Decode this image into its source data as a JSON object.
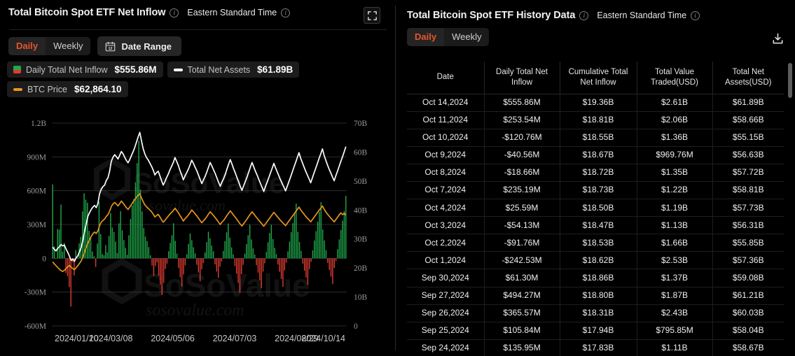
{
  "left": {
    "title": "Total Bitcoin Spot ETF Net Inflow",
    "timezone": "Eastern Standard Time",
    "info_glyph": "i",
    "fullscreen_icon": "fullscreen-icon",
    "period": {
      "daily": "Daily",
      "weekly": "Weekly",
      "active": "Daily"
    },
    "date_range_label": "Date Range",
    "calendar_icon_number": "12",
    "legend": [
      {
        "name": "Daily Total Net Inflow",
        "value": "$555.86M",
        "swatch": "split",
        "color_top": "#1faa4b",
        "color_bottom": "#e03c31"
      },
      {
        "name": "Total Net Assets",
        "value": "$61.89B",
        "swatch": "bar",
        "color": "#ffffff"
      },
      {
        "name": "BTC Price",
        "value": "$62,864.10",
        "swatch": "bar",
        "color": "#e8961e"
      }
    ],
    "watermark_main": "SoSoValue",
    "watermark_sub": "sosovalue.com"
  },
  "right": {
    "title": "Total Bitcoin Spot ETF History Data",
    "timezone": "Eastern Standard Time",
    "period": {
      "daily": "Daily",
      "weekly": "Weekly",
      "active": "Daily"
    },
    "download_icon": "download-icon",
    "columns": [
      "Date",
      "Daily Total Net Inflow",
      "Cumulative Total Net Inflow",
      "Total Value Traded(USD)",
      "Total Net Assets(USD)"
    ],
    "rows": [
      {
        "date": "Oct 14,2024",
        "daily": "$555.86M",
        "sign": "pos",
        "cum": "$19.36B",
        "traded": "$2.61B",
        "assets": "$61.89B"
      },
      {
        "date": "Oct 11,2024",
        "daily": "$253.54M",
        "sign": "pos",
        "cum": "$18.81B",
        "traded": "$2.06B",
        "assets": "$58.66B"
      },
      {
        "date": "Oct 10,2024",
        "daily": "-$120.76M",
        "sign": "neg",
        "cum": "$18.55B",
        "traded": "$1.36B",
        "assets": "$55.15B"
      },
      {
        "date": "Oct 9,2024",
        "daily": "-$40.56M",
        "sign": "neg",
        "cum": "$18.67B",
        "traded": "$969.76M",
        "assets": "$56.63B"
      },
      {
        "date": "Oct 8,2024",
        "daily": "-$18.66M",
        "sign": "neg",
        "cum": "$18.72B",
        "traded": "$1.35B",
        "assets": "$57.72B"
      },
      {
        "date": "Oct 7,2024",
        "daily": "$235.19M",
        "sign": "pos",
        "cum": "$18.73B",
        "traded": "$1.22B",
        "assets": "$58.81B"
      },
      {
        "date": "Oct 4,2024",
        "daily": "$25.59M",
        "sign": "pos",
        "cum": "$18.50B",
        "traded": "$1.19B",
        "assets": "$57.73B"
      },
      {
        "date": "Oct 3,2024",
        "daily": "-$54.13M",
        "sign": "neg",
        "cum": "$18.47B",
        "traded": "$1.13B",
        "assets": "$56.31B"
      },
      {
        "date": "Oct 2,2024",
        "daily": "-$91.76M",
        "sign": "neg",
        "cum": "$18.53B",
        "traded": "$1.66B",
        "assets": "$55.85B"
      },
      {
        "date": "Oct 1,2024",
        "daily": "-$242.53M",
        "sign": "neg",
        "cum": "$18.62B",
        "traded": "$2.53B",
        "assets": "$57.36B"
      },
      {
        "date": "Sep 30,2024",
        "daily": "$61.30M",
        "sign": "pos",
        "cum": "$18.86B",
        "traded": "$1.37B",
        "assets": "$59.08B"
      },
      {
        "date": "Sep 27,2024",
        "daily": "$494.27M",
        "sign": "pos",
        "cum": "$18.80B",
        "traded": "$1.87B",
        "assets": "$61.21B"
      },
      {
        "date": "Sep 26,2024",
        "daily": "$365.57M",
        "sign": "pos",
        "cum": "$18.31B",
        "traded": "$2.43B",
        "assets": "$60.03B"
      },
      {
        "date": "Sep 25,2024",
        "daily": "$105.84M",
        "sign": "pos",
        "cum": "$17.94B",
        "traded": "$795.85M",
        "assets": "$58.04B"
      },
      {
        "date": "Sep 24,2024",
        "daily": "$135.95M",
        "sign": "pos",
        "cum": "$17.83B",
        "traded": "$1.11B",
        "assets": "$58.67B"
      }
    ],
    "watermark_main": "SoSoValue",
    "watermark_sub": "sosovalue.com"
  },
  "chart_data": {
    "type": "bar",
    "title": "Total Bitcoin Spot ETF Net Inflow",
    "xlabel": "",
    "ylabel": "Daily Total Net Inflow",
    "y2label": "Total Net Assets / BTC Price",
    "grid": true,
    "legend_position": "top-left",
    "ylim": [
      -600000000,
      1200000000
    ],
    "y2lim": [
      0,
      70000000000
    ],
    "yticks": [
      "-600M",
      "-300M",
      "0",
      "300M",
      "600M",
      "900M",
      "1.2B"
    ],
    "y2ticks": [
      "0",
      "10B",
      "20B",
      "30B",
      "40B",
      "50B",
      "60B",
      "70B"
    ],
    "xticks": [
      "2024/01/10",
      "2024/03/08",
      "2024/05/06",
      "2024/07/03",
      "2024/08/29",
      "2024/10/14"
    ],
    "colors": {
      "positive_bar": "#1faa4b",
      "negative_bar": "#e03c31",
      "net_assets_line": "#ffffff",
      "btc_price_line": "#e8961e"
    },
    "series": [
      {
        "name": "Daily Total Net Inflow",
        "type": "bar",
        "axis": "left",
        "values": [
          655,
          106,
          -6,
          261,
          255,
          477,
          59,
          137,
          -131,
          -158,
          -255,
          -428,
          -36,
          -152,
          73,
          6,
          132,
          190,
          416,
          576,
          520,
          493,
          243,
          183,
          60,
          18,
          -76,
          131,
          505,
          215,
          38,
          27,
          117,
          53,
          198,
          402,
          273,
          233,
          148,
          47,
          310,
          418,
          248,
          162,
          93,
          32,
          205,
          349,
          468,
          527,
          676,
          845,
          1045,
          610,
          417,
          268,
          193,
          152,
          100,
          27,
          -64,
          -156,
          -68,
          -36,
          -154,
          -233,
          -326,
          -218,
          -95,
          -47,
          63,
          137,
          205,
          311,
          155,
          42,
          -87,
          -168,
          -251,
          -143,
          -62,
          35,
          128,
          220,
          161,
          98,
          44,
          -58,
          -126,
          -204,
          -98,
          -43,
          52,
          144,
          236,
          178,
          113,
          63,
          -54,
          -118,
          -173,
          -75,
          -28,
          66,
          152,
          231,
          309,
          184,
          97,
          36,
          -69,
          -137,
          -219,
          -306,
          -141,
          -58,
          41,
          126,
          206,
          298,
          167,
          88,
          33,
          -61,
          -127,
          -196,
          -265,
          -118,
          -44,
          56,
          143,
          225,
          297,
          171,
          92,
          38,
          -56,
          -119,
          -183,
          -253,
          -107,
          -39,
          61,
          148,
          232,
          312,
          404,
          486,
          235,
          145,
          66,
          -48,
          -110,
          -171,
          -236,
          -96,
          -31,
          71,
          158,
          241,
          325,
          412,
          498,
          256,
          159,
          73,
          -41,
          -103,
          -162,
          -228,
          -86,
          -25,
          81,
          168,
          251,
          335,
          421,
          555
        ],
        "unit": "millions USD"
      },
      {
        "name": "Total Net Assets",
        "type": "line",
        "axis": "right",
        "values": [
          27.2,
          26.4,
          25.9,
          26.8,
          27.3,
          28.1,
          27.6,
          27.9,
          26.5,
          25.4,
          24.1,
          22.6,
          23.1,
          22.3,
          23.5,
          24.2,
          25.6,
          27.1,
          29.4,
          32.6,
          35.2,
          37.8,
          39.1,
          40.2,
          41.0,
          41.6,
          40.8,
          42.3,
          45.6,
          47.2,
          48.1,
          48.6,
          50.2,
          51.1,
          53.4,
          56.8,
          58.2,
          59.1,
          58.4,
          57.6,
          58.9,
          60.2,
          59.4,
          58.2,
          57.1,
          56.3,
          57.4,
          58.8,
          60.1,
          61.6,
          63.4,
          65.2,
          66.8,
          63.9,
          61.2,
          59.4,
          58.1,
          57.3,
          56.2,
          55.1,
          53.8,
          52.1,
          52.9,
          53.4,
          51.8,
          50.1,
          48.6,
          49.8,
          51.2,
          52.4,
          53.9,
          55.1,
          56.4,
          58.1,
          56.8,
          55.4,
          53.6,
          52.1,
          50.4,
          51.8,
          52.9,
          54.1,
          55.6,
          57.2,
          56.1,
          54.8,
          53.6,
          52.1,
          50.6,
          49.1,
          50.4,
          51.6,
          53.1,
          54.8,
          56.4,
          55.2,
          53.9,
          52.6,
          51.1,
          49.6,
          48.2,
          49.6,
          50.8,
          52.3,
          54.1,
          55.8,
          57.4,
          55.9,
          54.2,
          52.8,
          51.2,
          49.7,
          48.1,
          46.8,
          48.4,
          49.9,
          51.4,
          53.1,
          54.8,
          56.4,
          54.9,
          53.4,
          52.1,
          50.6,
          49.2,
          47.8,
          46.4,
          48.1,
          49.6,
          51.2,
          52.8,
          54.4,
          56.1,
          54.6,
          53.2,
          51.8,
          50.4,
          49.1,
          47.9,
          46.6,
          48.2,
          49.8,
          51.4,
          53.1,
          54.8,
          56.4,
          58.1,
          59.8,
          57.9,
          56.4,
          54.9,
          53.4,
          52.1,
          50.8,
          49.4,
          51.1,
          52.8,
          54.4,
          56.1,
          57.8,
          59.4,
          61.1,
          58.9,
          57.2,
          55.6,
          54.1,
          52.8,
          51.4,
          50.1,
          51.8,
          53.4,
          55.1,
          56.8,
          58.4,
          60.1,
          61.89
        ],
        "unit": "billions USD"
      },
      {
        "name": "BTC Price",
        "type": "line",
        "axis": "right",
        "values": [
          22.1,
          21.4,
          20.8,
          20.2,
          19.6,
          19.1,
          18.8,
          19.2,
          19.8,
          20.4,
          20.9,
          20.3,
          19.8,
          19.4,
          20.1,
          20.8,
          21.6,
          22.4,
          23.8,
          25.4,
          27.1,
          28.6,
          29.8,
          30.9,
          31.8,
          32.4,
          31.9,
          32.8,
          34.6,
          35.8,
          36.4,
          36.9,
          37.8,
          38.4,
          39.6,
          41.2,
          42.1,
          42.6,
          42.1,
          41.4,
          42.2,
          43.1,
          42.4,
          41.6,
          40.8,
          40.2,
          41.0,
          41.9,
          42.8,
          43.6,
          44.4,
          45.1,
          45.6,
          44.2,
          42.9,
          41.8,
          41.1,
          40.6,
          40.0,
          39.4,
          38.6,
          37.6,
          38.1,
          38.5,
          37.6,
          36.6,
          35.8,
          36.4,
          37.2,
          37.9,
          38.6,
          39.2,
          39.8,
          40.6,
          39.9,
          39.1,
          38.1,
          37.2,
          36.2,
          37.0,
          37.6,
          38.3,
          39.1,
          40.0,
          39.4,
          38.7,
          38.0,
          37.2,
          36.4,
          35.6,
          36.3,
          36.9,
          37.7,
          38.6,
          39.4,
          38.8,
          38.1,
          37.4,
          36.6,
          35.8,
          35.0,
          35.8,
          36.4,
          37.2,
          38.1,
          38.9,
          39.7,
          39.0,
          38.2,
          37.5,
          36.7,
          35.9,
          35.1,
          34.5,
          35.3,
          36.1,
          36.9,
          37.8,
          38.6,
          39.4,
          38.7,
          37.9,
          37.2,
          36.5,
          35.8,
          35.1,
          34.4,
          35.2,
          36.0,
          36.8,
          37.6,
          38.4,
          39.2,
          38.5,
          37.8,
          37.1,
          36.4,
          35.8,
          35.2,
          34.6,
          35.4,
          36.2,
          37.0,
          37.8,
          38.6,
          39.4,
          40.2,
          41.0,
          40.1,
          39.3,
          38.6,
          37.8,
          37.2,
          36.6,
          35.9,
          36.7,
          37.5,
          38.3,
          39.1,
          39.9,
          40.6,
          41.4,
          40.3,
          39.4,
          38.6,
          37.9,
          37.2,
          36.6,
          35.9,
          36.7,
          37.5,
          38.3,
          39.0,
          38.4,
          38.9,
          38.2
        ],
        "unit": "scaled to right axis"
      }
    ]
  }
}
